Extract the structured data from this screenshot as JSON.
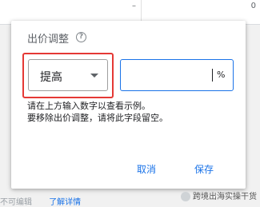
{
  "background": {
    "table_values": [
      "–",
      "0"
    ],
    "footer_text": "不可编辑",
    "footer_link": "了解详情"
  },
  "dialog": {
    "title": "出价调整",
    "help_icon": "help-circle-icon",
    "adjust_select": {
      "selected": "提高",
      "icon": "dropdown-caret-icon"
    },
    "percent_input": {
      "value": "",
      "suffix": "%"
    },
    "helper_line1": "请在上方输入数字以查看示例。",
    "helper_line2": "要移除出价调整，请将此字段留空。",
    "cancel_label": "取消",
    "save_label": "保存"
  },
  "colors": {
    "accent": "#1a73e8",
    "highlight": "#e53935"
  },
  "watermark": {
    "text": "跨境出海实操干货",
    "icon": "wechat-icon"
  }
}
